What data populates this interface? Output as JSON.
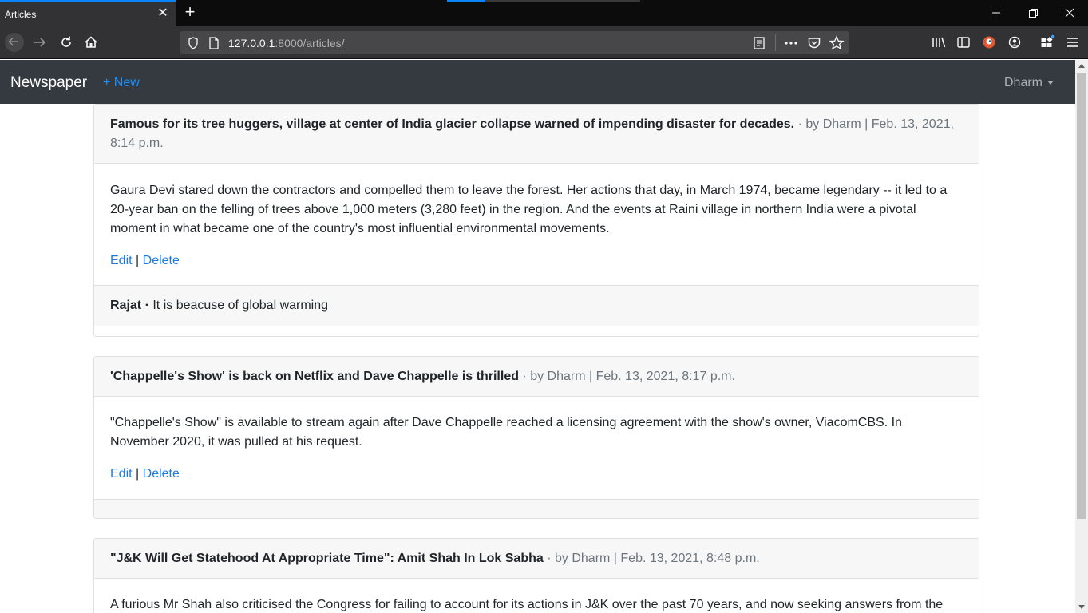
{
  "browser": {
    "tab_title": "Articles",
    "url_host": "127.0.0.1",
    "url_rest": ":8000/articles/"
  },
  "navbar": {
    "brand": "Newspaper",
    "new_link": "+ New",
    "user": "Dharm"
  },
  "articles": [
    {
      "title": "Famous for its tree huggers, village at center of India glacier collapse warned of impending disaster for decades.",
      "meta": " · by Dharm | Feb. 13, 2021, 8:14 p.m.",
      "body": "Gaura Devi stared down the contractors and compelled them to leave the forest. Her actions that day, in March 1974, became legendary -- it led to a 20-year ban on the felling of trees above 1,000 meters (3,280 feet) in the region. And the events at Raini village in northern India were a pivotal moment in what became one of the country's most influential environmental movements.",
      "edit": "Edit",
      "separator": "|",
      "delete": "Delete",
      "comments": [
        {
          "author": "Rajat ·",
          "text": "It is beacuse of global warming"
        }
      ]
    },
    {
      "title": "'Chappelle's Show' is back on Netflix and Dave Chappelle is thrilled",
      "meta": " · by Dharm | Feb. 13, 2021, 8:17 p.m.",
      "body": "\"Chappelle's Show\" is available to stream again after Dave Chappelle reached a licensing agreement with the show's owner, ViacomCBS. In November 2020, it was pulled at his request.",
      "edit": "Edit",
      "separator": "|",
      "delete": "Delete",
      "comments": []
    },
    {
      "title": "\"J&K Will Get Statehood At Appropriate Time\": Amit Shah In Lok Sabha",
      "meta": " · by Dharm | Feb. 13, 2021, 8:48 p.m.",
      "body": "A furious Mr Shah also criticised the Congress for failing to account for its actions in J&K over the past 70 years, and now seeking answers from the"
    }
  ]
}
